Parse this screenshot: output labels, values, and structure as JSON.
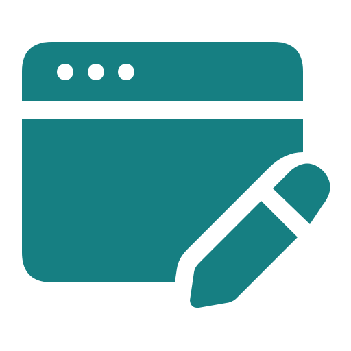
{
  "icon": {
    "name": "edit-web-page-icon",
    "color": "#167f82",
    "background": "#ffffff",
    "parts": [
      "browser-window",
      "title-bar-dots",
      "pencil"
    ]
  }
}
